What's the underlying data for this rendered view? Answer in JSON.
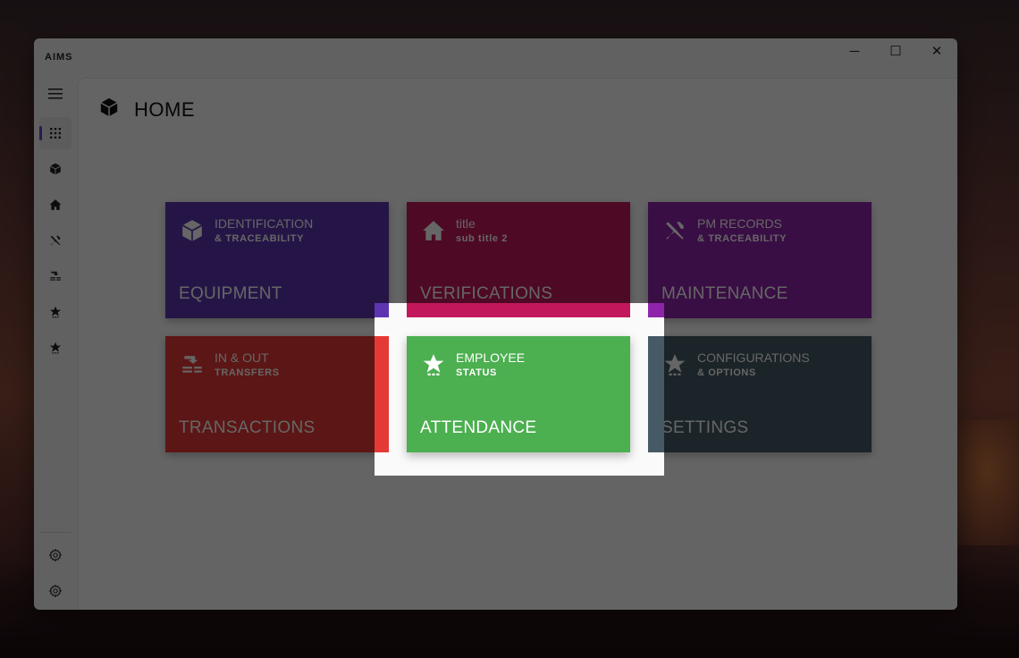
{
  "app": {
    "title": "AIMS"
  },
  "window_controls": {
    "minimize": "─",
    "maximize": "☐",
    "close": "✕"
  },
  "page": {
    "title": "HOME",
    "icon": "cube-icon"
  },
  "sidebar": {
    "items": [
      {
        "name": "hamburger-menu-icon"
      },
      {
        "name": "apps-grid-icon",
        "active": true
      },
      {
        "name": "cube-icon"
      },
      {
        "name": "home-icon"
      },
      {
        "name": "tools-icon"
      },
      {
        "name": "transfer-icon"
      },
      {
        "name": "star-icon"
      },
      {
        "name": "star-icon"
      }
    ],
    "footer": [
      {
        "name": "gear-icon"
      },
      {
        "name": "gear-icon"
      }
    ]
  },
  "tiles": [
    {
      "id": "equipment",
      "line1": "IDENTIFICATION",
      "line2": "& TRACEABILITY",
      "main": "EQUIPMENT",
      "icon": "cube-icon",
      "color": "#5e35b1"
    },
    {
      "id": "verifications",
      "line1": "title",
      "line2": "sub title 2",
      "main": "VERIFICATIONS",
      "icon": "home-icon",
      "color": "#c2185b"
    },
    {
      "id": "maintenance",
      "line1": "PM RECORDS",
      "line2": "& TRACEABILITY",
      "main": "MAINTENANCE",
      "icon": "tools-icon",
      "color": "#8e24aa"
    },
    {
      "id": "transactions",
      "line1": "IN & OUT",
      "line2": "TRANSFERS",
      "main": "TRANSACTIONS",
      "icon": "transfer-icon",
      "color": "#e53935"
    },
    {
      "id": "attendance",
      "line1": "EMPLOYEE",
      "line2": "STATUS",
      "main": "ATTENDANCE",
      "icon": "star-icon",
      "color": "#4caf50"
    },
    {
      "id": "settings",
      "line1": "CONFIGURATIONS",
      "line2": "& OPTIONS",
      "main": "SETTINGS",
      "icon": "star-icon",
      "color": "#455a64"
    }
  ],
  "overlay_color": "rgba(0,0,0,0.6)"
}
